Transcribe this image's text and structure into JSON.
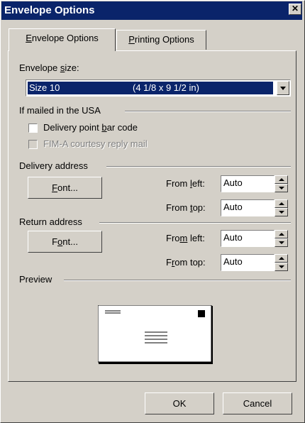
{
  "window": {
    "title": "Envelope Options",
    "close_icon": "close-icon"
  },
  "tabs": [
    {
      "label": "Envelope Options",
      "accel": "E",
      "active": true
    },
    {
      "label": "Printing Options",
      "accel": "P",
      "active": false
    }
  ],
  "envelope_size": {
    "label": "Envelope size:",
    "selected_name": "Size 10",
    "selected_dims": "(4 1/8 x 9 1/2 in)"
  },
  "usa_group": {
    "heading": "If mailed in the USA",
    "delivery_bar_code": {
      "label": "Delivery point bar code",
      "checked": false
    },
    "fim_a": {
      "label": "FIM-A courtesy reply mail",
      "checked": false,
      "disabled": true
    }
  },
  "delivery_address": {
    "heading": "Delivery address",
    "font_button": "Font...",
    "from_left_label": "From left:",
    "from_left_value": "Auto",
    "from_top_label": "From top:",
    "from_top_value": "Auto"
  },
  "return_address": {
    "heading": "Return address",
    "font_button": "Font...",
    "from_left_label": "From left:",
    "from_left_value": "Auto",
    "from_top_label": "From top:",
    "from_top_value": "Auto"
  },
  "preview": {
    "heading": "Preview"
  },
  "footer": {
    "ok_label": "OK",
    "cancel_label": "Cancel"
  },
  "colors": {
    "titlebar": "#0a246a",
    "face": "#d4d0c8",
    "selection": "#0a246a"
  }
}
